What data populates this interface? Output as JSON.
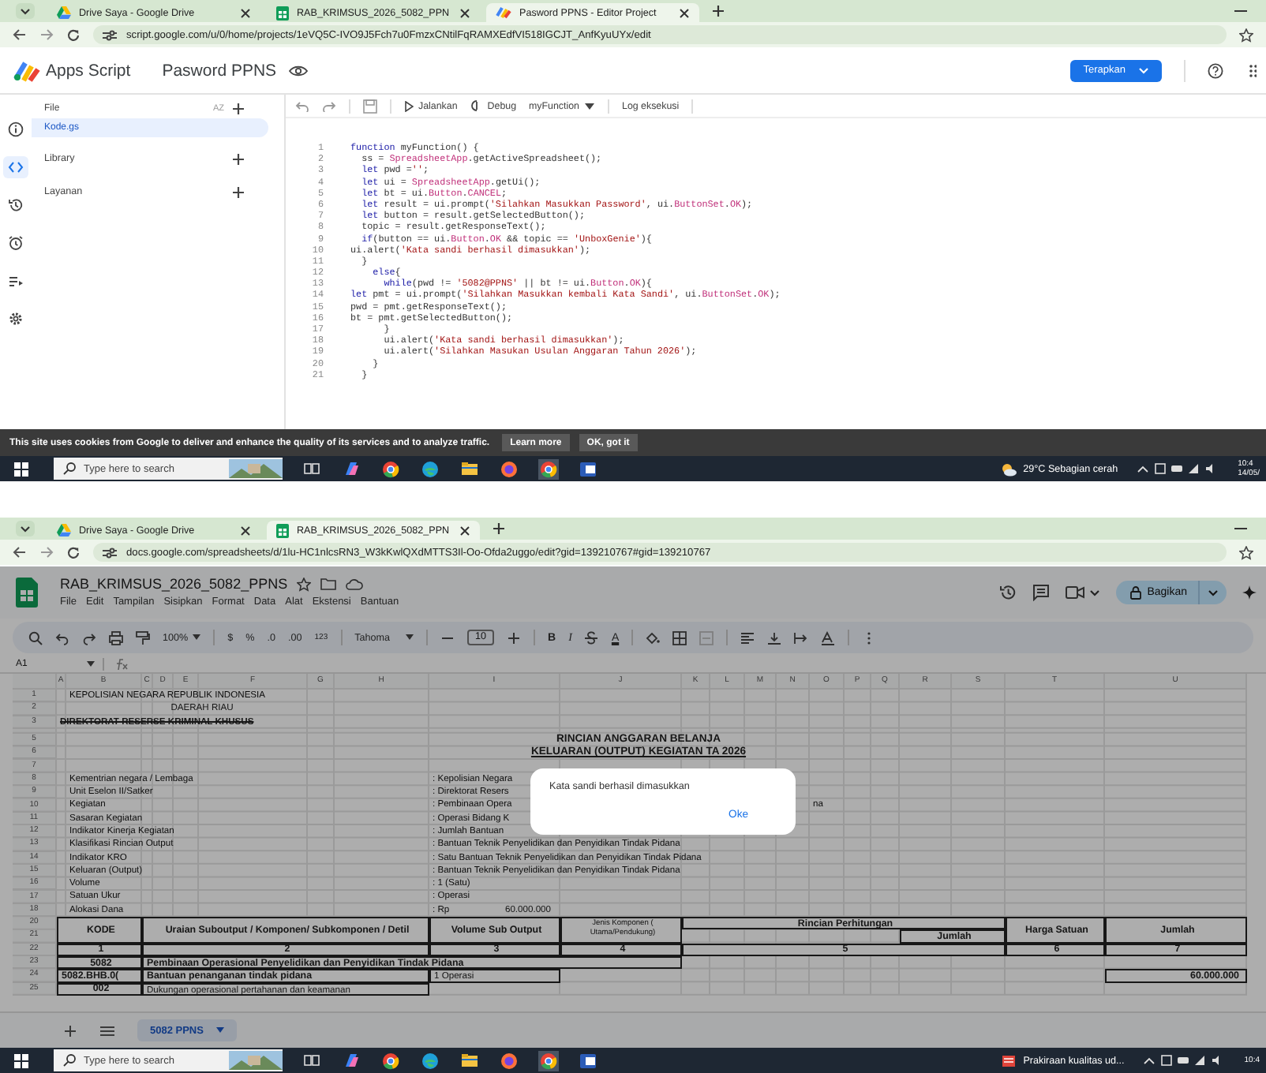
{
  "top_window": {
    "tabs": [
      {
        "kind": "drive",
        "label": "Drive Saya - Google Drive",
        "selected": false
      },
      {
        "kind": "sheets",
        "label": "RAB_KRIMSUS_2026_5082_PPN",
        "selected": false
      },
      {
        "kind": "script",
        "label": "Pasword PPNS - Editor Project",
        "selected": true
      }
    ],
    "url": "script.google.com/u/0/home/projects/1eVQ5C-IVO9J5Fch7u0FmzxCNtilFqRAMXEdfVI518IGCJT_AnfKyuUYx/edit",
    "app_name": "Apps Script",
    "project_title": "Pasword PPNS",
    "deploy_button": "Terapkan",
    "rail_items": [
      {
        "selected": false
      },
      {
        "selected": true
      },
      {
        "selected": false
      },
      {
        "selected": false
      },
      {
        "selected": false
      },
      {
        "selected": false
      }
    ],
    "files_header": "File",
    "sort_label": "AZ",
    "files": [
      {
        "label": "Kode.gs",
        "selected": true
      }
    ],
    "sections": [
      {
        "label": "Library"
      },
      {
        "label": "Layanan"
      }
    ],
    "toolbar": {
      "run": "Jalankan",
      "debug": "Debug",
      "function": "myFunction",
      "log": "Log eksekusi"
    },
    "code_lines": [
      {
        "number": "1",
        "text": "function myFunction() {"
      },
      {
        "number": "2",
        "text": "  ss = SpreadsheetApp.getActiveSpreadsheet();"
      },
      {
        "number": "3",
        "text": "  let pwd ='';"
      },
      {
        "number": "4",
        "text": "  let ui = SpreadsheetApp.getUi();"
      },
      {
        "number": "5",
        "text": "  let bt = ui.Button.CANCEL;"
      },
      {
        "number": "6",
        "text": "  let result = ui.prompt('Silahkan Masukkan Password', ui.ButtonSet.OK);"
      },
      {
        "number": "7",
        "text": "  let button = result.getSelectedButton();"
      },
      {
        "number": "8",
        "text": "  topic = result.getResponseText();"
      },
      {
        "number": "9",
        "text": "  if(button == ui.Button.OK && topic == 'UnboxGenie'){"
      },
      {
        "number": "10",
        "text": "ui.alert('Kata sandi berhasil dimasukkan');"
      },
      {
        "number": "11",
        "text": "  }"
      },
      {
        "number": "12",
        "text": "    else{"
      },
      {
        "number": "13",
        "text": "      while(pwd != '5082@PPNS' || bt != ui.Button.OK){"
      },
      {
        "number": "14",
        "text": "let pmt = ui.prompt('Silahkan Masukkan kembali Kata Sandi', ui.ButtonSet.OK);"
      },
      {
        "number": "15",
        "text": "pwd = pmt.getResponseText();"
      },
      {
        "number": "16",
        "text": "bt = pmt.getSelectedButton();"
      },
      {
        "number": "17",
        "text": "      }"
      },
      {
        "number": "18",
        "text": "      ui.alert('Kata sandi berhasil dimasukkan');"
      },
      {
        "number": "19",
        "text": "      ui.alert('Silahkan Masukan Usulan Anggaran Tahun 2026');"
      },
      {
        "number": "20",
        "text": "    }"
      },
      {
        "number": "21",
        "text": "  }"
      }
    ],
    "cookie_notice": {
      "text": "This site uses cookies from Google to deliver and enhance the quality of its services and to analyze traffic.",
      "buttons": [
        "Learn more",
        "OK, got it"
      ]
    }
  },
  "top_taskbar": {
    "search_placeholder": "Type here to search",
    "status": "29°C  Sebagian cerah",
    "clock": [
      "10:4",
      "14/05/"
    ]
  },
  "bottom_window": {
    "tabs": [
      {
        "kind": "drive",
        "label": "Drive Saya - Google Drive",
        "selected": false
      },
      {
        "kind": "sheets",
        "label": "RAB_KRIMSUS_2026_5082_PPN",
        "selected": true
      }
    ],
    "url": "docs.google.com/spreadsheets/d/1lu-HC1nlcsRN3_W3kKwlQXdMTTS3Il-Oo-Ofda2uggo/edit?gid=139210767#gid=139210767",
    "doc_title": "RAB_KRIMSUS_2026_5082_PPNS",
    "menu": [
      "File",
      "Edit",
      "Tampilan",
      "Sisipkan",
      "Format",
      "Data",
      "Alat",
      "Ekstensi",
      "Bantuan"
    ],
    "share_button": "Bagikan",
    "toolbar": {
      "zoom": "100%",
      "currency": "$",
      "percent": "%",
      "decimal_less": ".0",
      "decimal_more": ".00",
      "number_format": "123",
      "font": "Tahoma",
      "font_size": "10",
      "bold": "B",
      "italic": "I",
      "text_color": "A"
    },
    "cell_ref": "A1",
    "column_letters": [
      "A",
      "B",
      "C",
      "D",
      "E",
      "F",
      "G",
      "H",
      "I",
      "J",
      "K",
      "L",
      "M",
      "N",
      "O",
      "P",
      "Q",
      "R",
      "S",
      "T",
      "U"
    ],
    "sheet_lines": [
      {
        "kind": "plain",
        "numbers": [
          "1"
        ],
        "cells": [
          {
            "kind": "title",
            "text": "KEPOLISIAN NEGARA REPUBLIK INDONESIA"
          }
        ]
      },
      {
        "kind": "plain",
        "numbers": [
          "2"
        ],
        "cells": [
          {
            "kind": "center",
            "text": "DAERAH RIAU"
          }
        ]
      },
      {
        "kind": "plain",
        "numbers": [
          "3"
        ],
        "cells": [
          {
            "kind": "struck",
            "text": "DIREKTORAT RESERSE KRIMINAL KHUSUS"
          }
        ]
      },
      {
        "kind": "thin"
      },
      {
        "kind": "plain",
        "numbers": [
          "5"
        ],
        "cells": [
          {
            "kind": "heading",
            "text": "RINCIAN ANGGARAN BELANJA"
          }
        ]
      },
      {
        "kind": "plain",
        "numbers": [
          "6"
        ],
        "cells": [
          {
            "kind": "heading-underline",
            "text": "KELUARAN (OUTPUT) KEGIATAN TA 2026"
          }
        ]
      },
      {
        "kind": "plain",
        "numbers": [
          "7"
        ]
      },
      {
        "kind": "plain",
        "numbers": [
          "8"
        ],
        "cells": [
          {
            "kind": "label",
            "text": "Kementrian negara / Lembaga"
          },
          {
            "kind": "value",
            "text": ": Kepolisian Negara"
          }
        ]
      },
      {
        "kind": "plain",
        "numbers": [
          "9"
        ],
        "cells": [
          {
            "kind": "label",
            "text": "Unit Eselon II/Satker"
          },
          {
            "kind": "value",
            "text": ": Direktorat Resers"
          }
        ]
      },
      {
        "kind": "plain",
        "numbers": [
          "10"
        ],
        "cells": [
          {
            "kind": "label",
            "text": "Kegiatan"
          },
          {
            "kind": "value",
            "text": ": Pembinaan Opera"
          },
          {
            "kind": "tail",
            "text": "na"
          }
        ]
      },
      {
        "kind": "plain",
        "numbers": [
          "11"
        ],
        "cells": [
          {
            "kind": "label",
            "text": "Sasaran Kegiatan"
          },
          {
            "kind": "value",
            "text": ": Operasi Bidang K"
          }
        ]
      },
      {
        "kind": "plain",
        "numbers": [
          "12"
        ],
        "cells": [
          {
            "kind": "label",
            "text": "Indikator Kinerja Kegiatan"
          },
          {
            "kind": "value",
            "text": ": Jumlah Bantuan"
          }
        ]
      },
      {
        "kind": "plain",
        "numbers": [
          "13"
        ],
        "cells": [
          {
            "kind": "label",
            "text": "Klasifikasi Rincian Output"
          },
          {
            "kind": "value",
            "text": ": Bantuan Teknik Penyelidikan dan Penyidikan Tindak Pidana"
          }
        ]
      },
      {
        "kind": "plain",
        "numbers": [
          "14"
        ],
        "cells": [
          {
            "kind": "label",
            "text": "Indikator KRO"
          },
          {
            "kind": "value",
            "text": ": Satu Bantuan Teknik Penyelidikan dan Penyidikan Tindak Pidana"
          }
        ]
      },
      {
        "kind": "plain",
        "numbers": [
          "15"
        ],
        "cells": [
          {
            "kind": "label",
            "text": "Keluaran (Output)"
          },
          {
            "kind": "value",
            "text": ": Bantuan Teknik Penyelidikan dan Penyidikan Tindak Pidana"
          }
        ]
      },
      {
        "kind": "plain",
        "numbers": [
          "16"
        ],
        "cells": [
          {
            "kind": "label",
            "text": "Volume"
          },
          {
            "kind": "value",
            "text": ": 1 (Satu)"
          }
        ]
      },
      {
        "kind": "plain",
        "numbers": [
          "17"
        ],
        "cells": [
          {
            "kind": "label",
            "text": "Satuan Ukur"
          },
          {
            "kind": "value",
            "text": ": Operasi"
          }
        ]
      },
      {
        "kind": "plain",
        "numbers": [
          "18"
        ],
        "cells": [
          {
            "kind": "label",
            "text": "Alokasi Dana"
          },
          {
            "kind": "value",
            "text": ": Rp"
          },
          {
            "kind": "amount",
            "text": "60.000.000"
          }
        ]
      },
      {
        "kind": "double",
        "numbers": [
          "20",
          "21"
        ],
        "cells": [
          {
            "kind": "kode-head",
            "text": "KODE"
          },
          {
            "kind": "uraian-head",
            "text": "Uraian Suboutput / Komponen/ Subkomponen / Detil"
          },
          {
            "kind": "volume-head",
            "text": "Volume Sub Output"
          },
          {
            "kind": "jenis-head",
            "text": "Jenis Komponen ( Utama/Pendukung)"
          },
          {
            "kind": "rincian-head",
            "text": "Rincian Perhitungan"
          },
          {
            "kind": "rincian-sub-head",
            "text": "Jumlah"
          },
          {
            "kind": "harga-head",
            "text": "Harga Satuan"
          },
          {
            "kind": "jumlah-head",
            "text": "Jumlah"
          }
        ]
      },
      {
        "kind": "plain",
        "numbers": [
          "22"
        ],
        "cells": [
          {
            "kind": "kode-head",
            "text": "1"
          },
          {
            "kind": "uraian-head",
            "text": "2"
          },
          {
            "kind": "volume-head",
            "text": "3"
          },
          {
            "kind": "jenis-num",
            "text": "4"
          },
          {
            "kind": "rincian-head",
            "text": "5"
          },
          {
            "kind": "harga-head",
            "text": "6"
          },
          {
            "kind": "jumlah-head",
            "text": "7"
          }
        ]
      },
      {
        "kind": "plain",
        "numbers": [
          "23"
        ],
        "cells": [
          {
            "kind": "kode-head",
            "text": "5082"
          },
          {
            "kind": "uraian-wide-bold",
            "text": "Pembinaan Operasional Penyelidikan dan Penyidikan Tindak Pidana"
          }
        ]
      },
      {
        "kind": "plain",
        "numbers": [
          "24"
        ],
        "cells": [
          {
            "kind": "kode-bold",
            "text": "5082.BHB.0("
          },
          {
            "kind": "uraian-bold",
            "text": "Bantuan penanganan tindak pidana"
          },
          {
            "kind": "volume-cell",
            "text": "1 Operasi"
          },
          {
            "kind": "jumlah-number",
            "text": "60.000.000"
          }
        ]
      },
      {
        "kind": "plain",
        "numbers": [
          "25"
        ],
        "cells": [
          {
            "kind": "kode-head",
            "text": "002"
          },
          {
            "kind": "uraian-cell",
            "text": "Dukungan operasional pertahanan dan keamanan"
          }
        ]
      }
    ],
    "dialog": {
      "message": "Kata sandi berhasil dimasukkan",
      "button": "Oke"
    },
    "sheets": [
      {
        "label": "5082 PPNS",
        "selected": true
      }
    ]
  },
  "bottom_taskbar": {
    "search_placeholder": "Type here to search",
    "status": "Prakiraan kualitas ud...",
    "clock": [
      "10:4"
    ]
  }
}
